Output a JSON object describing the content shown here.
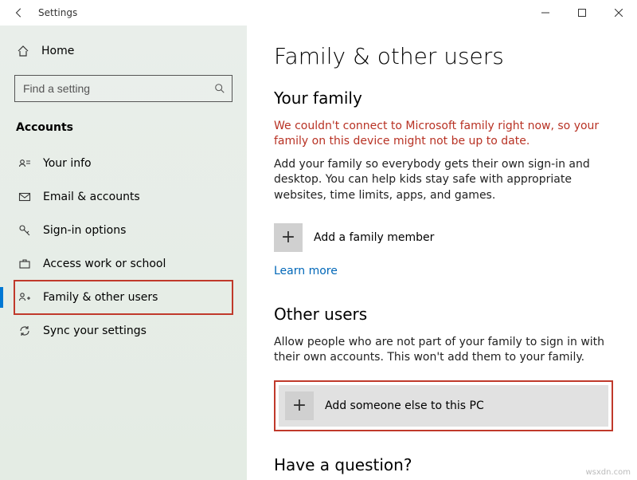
{
  "titlebar": {
    "title": "Settings"
  },
  "sidebar": {
    "home_label": "Home",
    "search_placeholder": "Find a setting",
    "section_label": "Accounts",
    "items": [
      {
        "label": "Your info"
      },
      {
        "label": "Email & accounts"
      },
      {
        "label": "Sign-in options"
      },
      {
        "label": "Access work or school"
      },
      {
        "label": "Family & other users"
      },
      {
        "label": "Sync your settings"
      }
    ]
  },
  "content": {
    "page_title": "Family & other users",
    "family": {
      "heading": "Your family",
      "error": "We couldn't connect to Microsoft family right now, so your family on this device might not be up to date.",
      "body": "Add your family so everybody gets their own sign-in and desktop. You can help kids stay safe with appropriate websites, time limits, apps, and games.",
      "add_label": "Add a family member",
      "learn_more": "Learn more"
    },
    "other": {
      "heading": "Other users",
      "body": "Allow people who are not part of your family to sign in with their own accounts. This won't add them to your family.",
      "add_label": "Add someone else to this PC"
    },
    "question_heading": "Have a question?"
  },
  "watermark": "wsxdn.com"
}
